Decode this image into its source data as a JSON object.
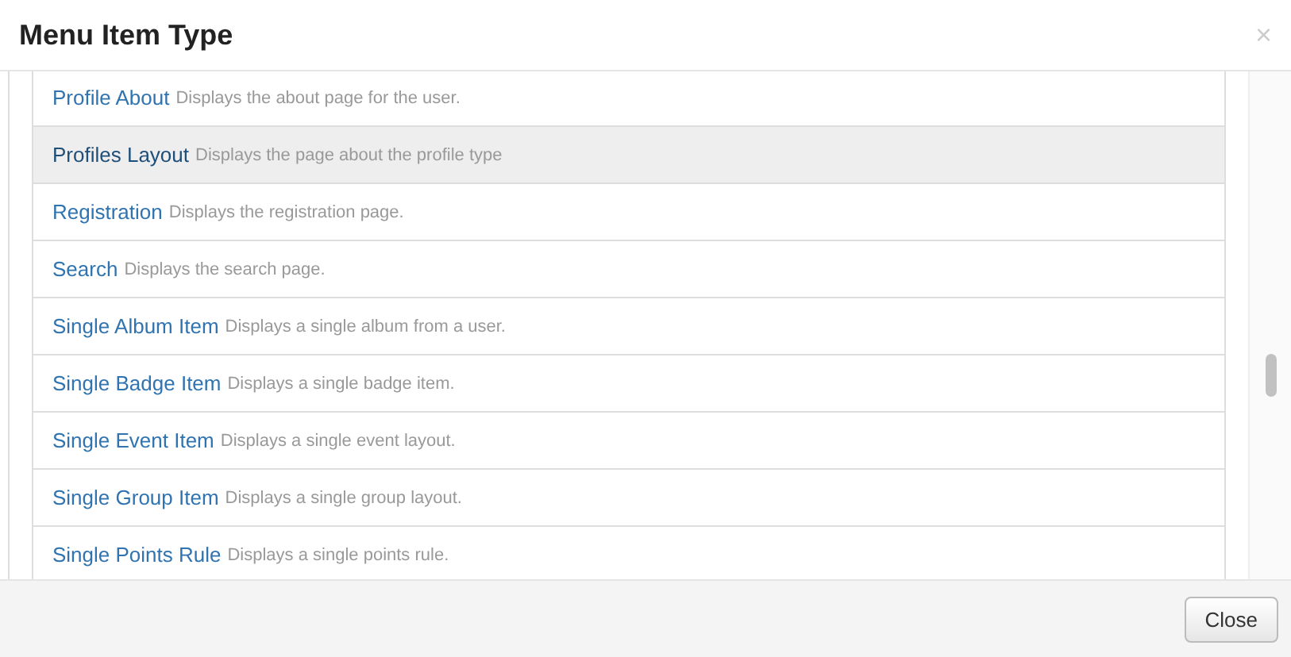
{
  "dialog": {
    "title": "Menu Item Type",
    "close_icon": "×"
  },
  "items": [
    {
      "name": "Profile About",
      "description": "Displays the about page for the user.",
      "selected": false
    },
    {
      "name": "Profiles Layout",
      "description": "Displays the page about the profile type",
      "selected": true
    },
    {
      "name": "Registration",
      "description": "Displays the registration page.",
      "selected": false
    },
    {
      "name": "Search",
      "description": "Displays the search page.",
      "selected": false
    },
    {
      "name": "Single Album Item",
      "description": "Displays a single album from a user.",
      "selected": false
    },
    {
      "name": "Single Badge Item",
      "description": "Displays a single badge item.",
      "selected": false
    },
    {
      "name": "Single Event Item",
      "description": "Displays a single event layout.",
      "selected": false
    },
    {
      "name": "Single Group Item",
      "description": "Displays a single group layout.",
      "selected": false
    },
    {
      "name": "Single Points Rule",
      "description": "Displays a single points rule.",
      "selected": false
    }
  ],
  "footer": {
    "close_button": "Close"
  }
}
